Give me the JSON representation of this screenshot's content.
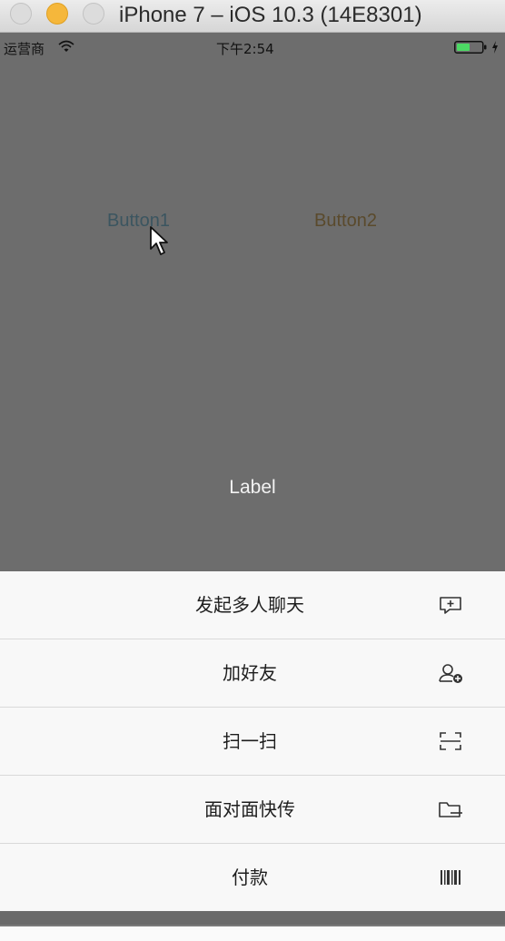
{
  "window": {
    "title": "iPhone 7 – iOS 10.3 (14E8301)"
  },
  "status_bar": {
    "carrier": "运营商",
    "time": "下午2:54",
    "battery_color": "#4cd964"
  },
  "content": {
    "button1": "Button1",
    "button2": "Button2",
    "label": "Label"
  },
  "action_sheet": {
    "items": [
      {
        "label": "发起多人聊天",
        "icon": "add-chat-icon"
      },
      {
        "label": "加好友",
        "icon": "add-friend-icon"
      },
      {
        "label": "扫一扫",
        "icon": "scan-icon"
      },
      {
        "label": "面对面快传",
        "icon": "folder-icon"
      },
      {
        "label": "付款",
        "icon": "barcode-icon"
      }
    ]
  }
}
